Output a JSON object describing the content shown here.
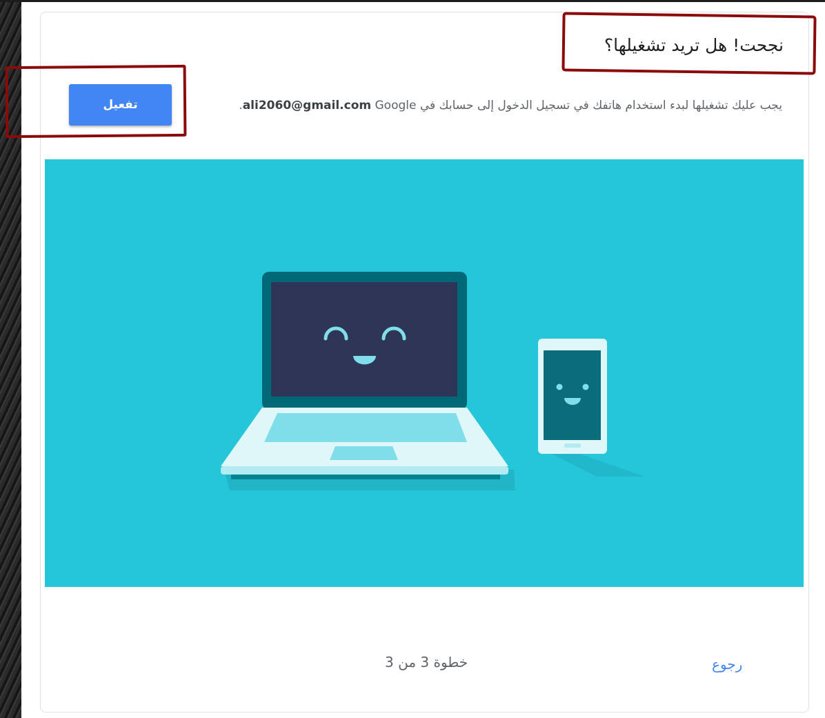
{
  "dialog": {
    "title": "نجحت! هل تريد تشغيلها؟",
    "description_before": "يجب عليك تشغيلها لبدء استخدام هاتفك في تسجيل الدخول إلى حسابك في",
    "account_email": "ali2060@gmail.com",
    "description_after": "Google.",
    "activate_label": "تفعيل",
    "step_text": "خطوة 3 من 3",
    "back_label": "رجوع"
  },
  "illustration": {
    "background_color": "#26c6da",
    "laptop_icon": "laptop-smiling-icon",
    "phone_icon": "phone-smiling-icon"
  },
  "annotations": {
    "highlight_color": "#8b0a0a"
  }
}
